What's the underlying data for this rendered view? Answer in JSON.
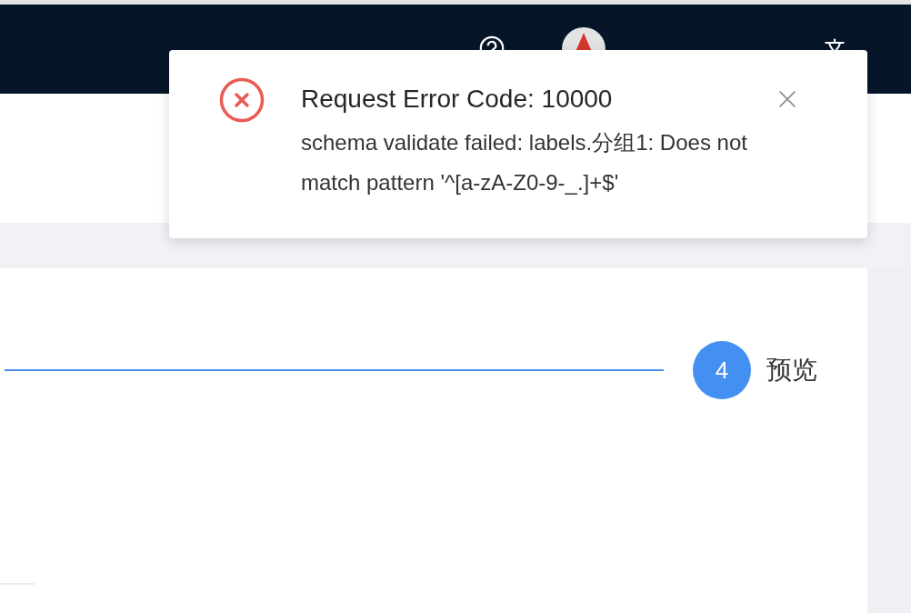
{
  "steps": [
    {
      "number": "4",
      "title": "预览",
      "current": true
    }
  ],
  "notification": {
    "kind": "error",
    "title": "Request Error Code: 10000",
    "description": "schema validate failed: labels.分组1: Does not match pattern '^[a-zA-Z0-9-_.]+$'"
  }
}
